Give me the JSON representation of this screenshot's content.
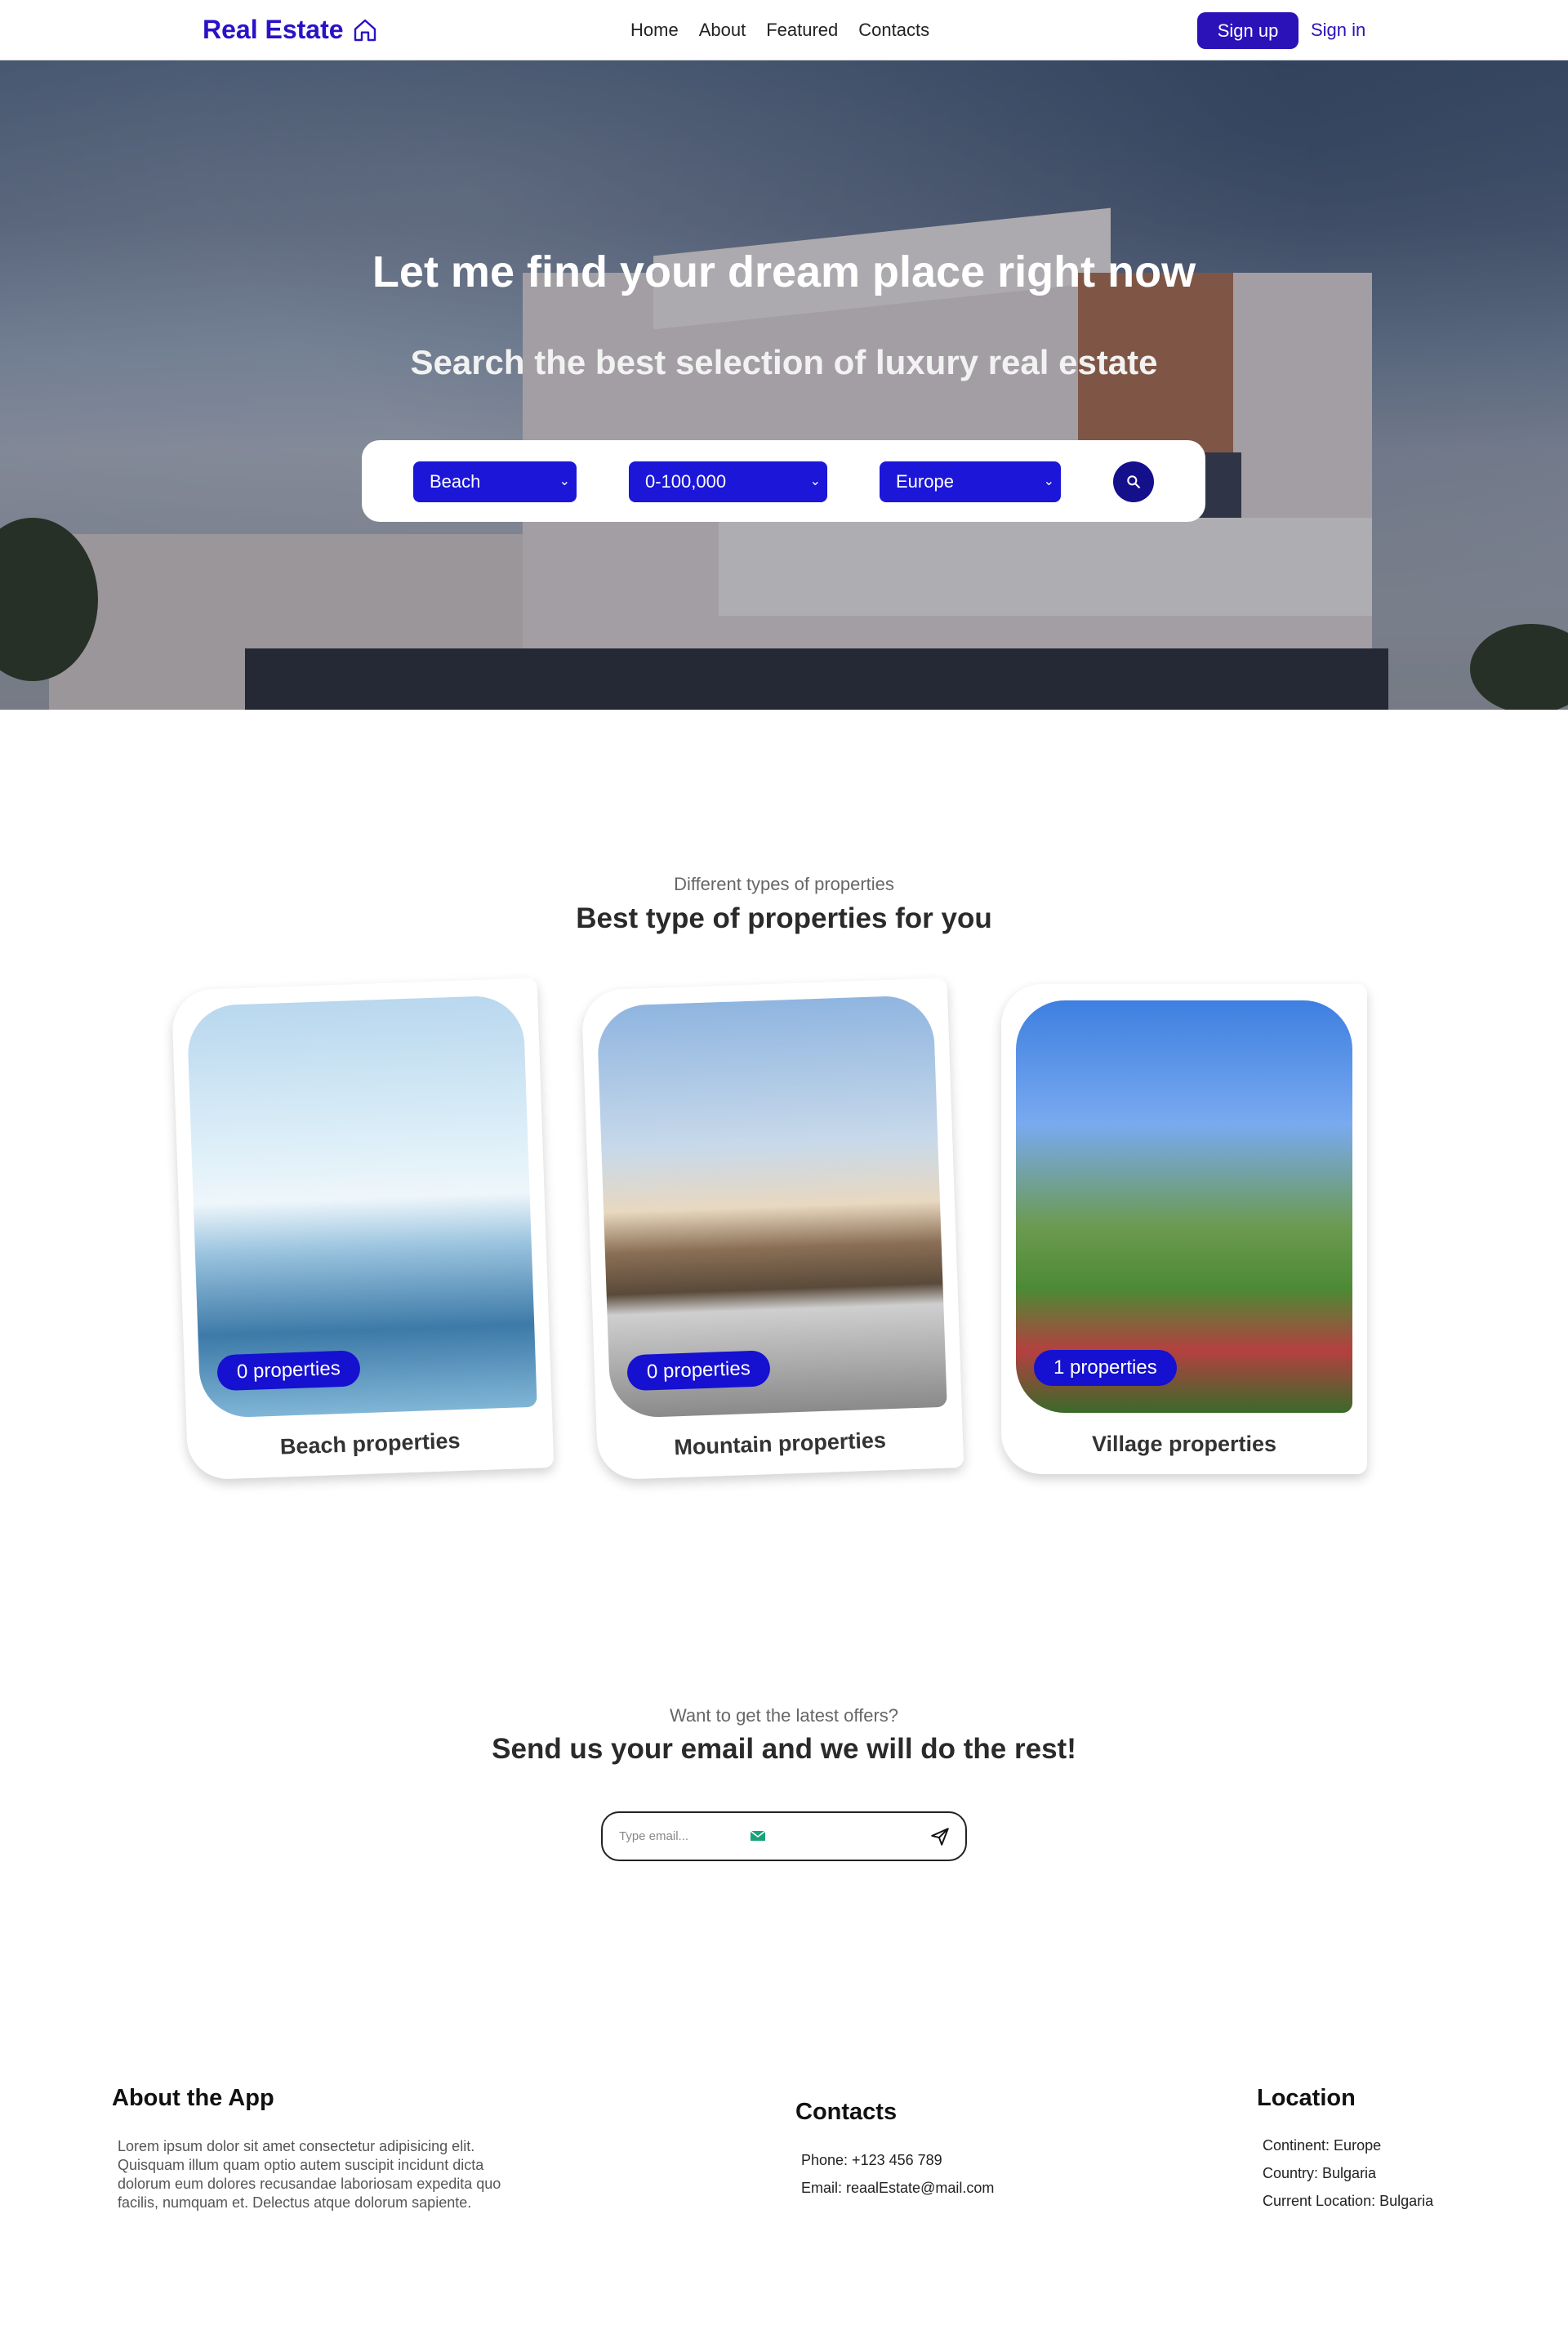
{
  "nav": {
    "logo": "Real Estate",
    "links": [
      "Home",
      "About",
      "Featured",
      "Contacts"
    ],
    "signup": "Sign up",
    "signin": "Sign in"
  },
  "hero": {
    "title": "Let me find your dream place right now",
    "subtitle": "Search the best selection of luxury real estate",
    "search": {
      "type": "Beach",
      "price": "0-100,000",
      "region": "Europe"
    }
  },
  "types": {
    "kicker": "Different types of properties",
    "title": "Best type of properties for you",
    "cards": [
      {
        "badge": "0 properties",
        "label": "Beach properties"
      },
      {
        "badge": "0 properties",
        "label": "Mountain properties"
      },
      {
        "badge": "1 properties",
        "label": "Village properties"
      }
    ]
  },
  "newsletter": {
    "kicker": "Want to get the latest offers?",
    "title": "Send us your email and we will do the rest!",
    "placeholder": "Type email..."
  },
  "footer": {
    "about": {
      "heading": "About the App",
      "lines": [
        "Lorem ipsum dolor sit amet consectetur adipisicing elit.",
        "Quisquam illum quam optio autem suscipit incidunt dicta",
        "dolorum eum dolores recusandae laboriosam expedita quo",
        "facilis, numquam et. Delectus atque dolorum sapiente."
      ]
    },
    "contacts": {
      "heading": "Contacts",
      "phone": "Phone: +123 456 789",
      "email": "Email: reaalEstate@mail.com"
    },
    "location": {
      "heading": "Location",
      "continent": "Continent: Europe",
      "country": "Country: Bulgaria",
      "current": "Current Location: Bulgaria"
    }
  },
  "colors": {
    "brand": "#2a12c8",
    "select": "#1b16d8",
    "badge": "#1610d0"
  },
  "icons": [
    "home-icon",
    "chevron-down-icon",
    "search-icon",
    "email-icon",
    "send-icon"
  ]
}
